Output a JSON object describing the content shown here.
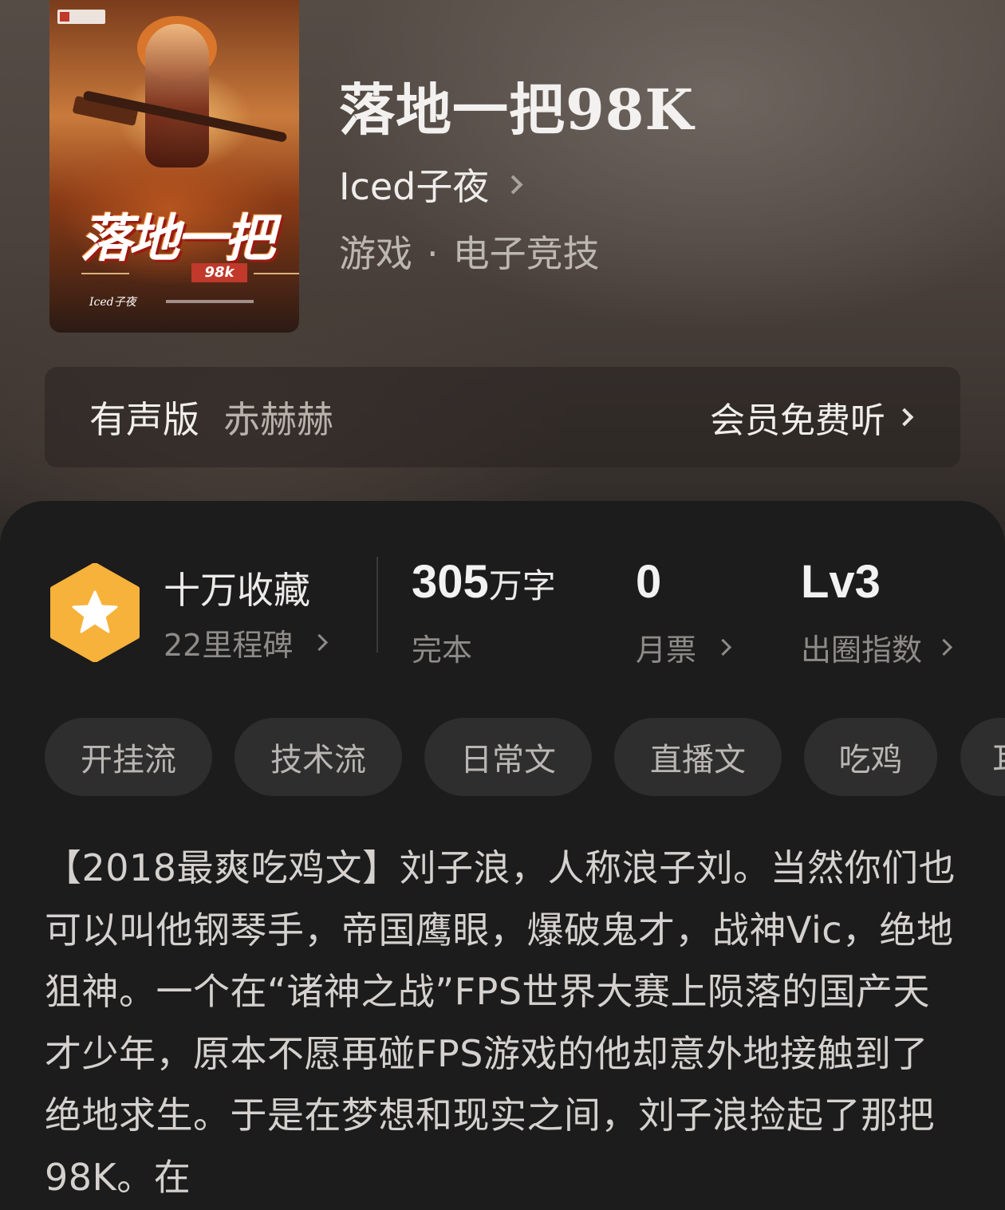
{
  "book": {
    "title": "落地一把98K",
    "author": "Iced子夜",
    "category": "游戏",
    "subcategory": "电子竞技",
    "separator": "·"
  },
  "cover": {
    "title_art": "落地一把",
    "badge_98k": "98k",
    "author_art": "Iced子夜"
  },
  "audio": {
    "label": "有声版",
    "narrator": "赤赫赫",
    "cta": "会员免费听"
  },
  "stats": {
    "collection": {
      "title": "十万收藏",
      "subtitle": "22里程碑"
    },
    "words": {
      "number": "305",
      "unit": "万字",
      "label": "完本"
    },
    "monthly_ticket": {
      "value": "0",
      "label": "月票"
    },
    "influence": {
      "value": "Lv3",
      "label": "出圈指数"
    }
  },
  "tags": [
    "开挂流",
    "技术流",
    "日常文",
    "直播文",
    "吃鸡",
    "耳"
  ],
  "intro": "【2018最爽吃鸡文】刘子浪，人称浪子刘。当然你们也可以叫他钢琴手，帝国鹰眼，爆破鬼才，战神Vic，绝地狙神。一个在“诸神之战”FPS世界大赛上陨落的国产天才少年，原本不愿再碰FPS游戏的他却意外地接触到了绝地求生。于是在梦想和现实之间，刘子浪捡起了那把98K。在",
  "colors": {
    "hex_badge": "#f7b23b",
    "background": "#1c1c1c",
    "tag_bg": "#2e2e2e"
  },
  "icons": {
    "author_arrow": "chevron-right-icon",
    "medal": "hexagon-star-icon"
  }
}
